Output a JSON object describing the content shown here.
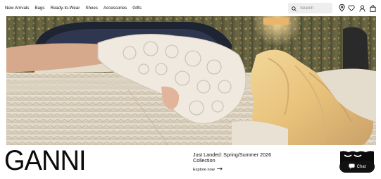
{
  "header": {
    "nav": [
      {
        "label": "New Arrivals"
      },
      {
        "label": "Bags"
      },
      {
        "label": "Ready-to-Wear"
      },
      {
        "label": "Shoes"
      },
      {
        "label": "Accessories"
      },
      {
        "label": "Gifts"
      }
    ],
    "search": {
      "placeholder": "Search",
      "value": ""
    },
    "icons": [
      "search-icon",
      "location-pin-icon",
      "heart-icon",
      "user-icon",
      "shopping-bag-icon"
    ]
  },
  "hero": {
    "description_icon": "hero-image"
  },
  "brand": {
    "logo_text": "GANNI"
  },
  "promo": {
    "title": "Just Landed: Spring/Summer 2026 Collection",
    "cta_label": "Explore now",
    "cta_icon": "arrow-right-icon"
  },
  "chat": {
    "label": "Chat",
    "icon": "chat-bubble-icon"
  },
  "colors": {
    "text": "#111111",
    "search_bg": "#eeeeee",
    "chat_bg": "#111111"
  }
}
